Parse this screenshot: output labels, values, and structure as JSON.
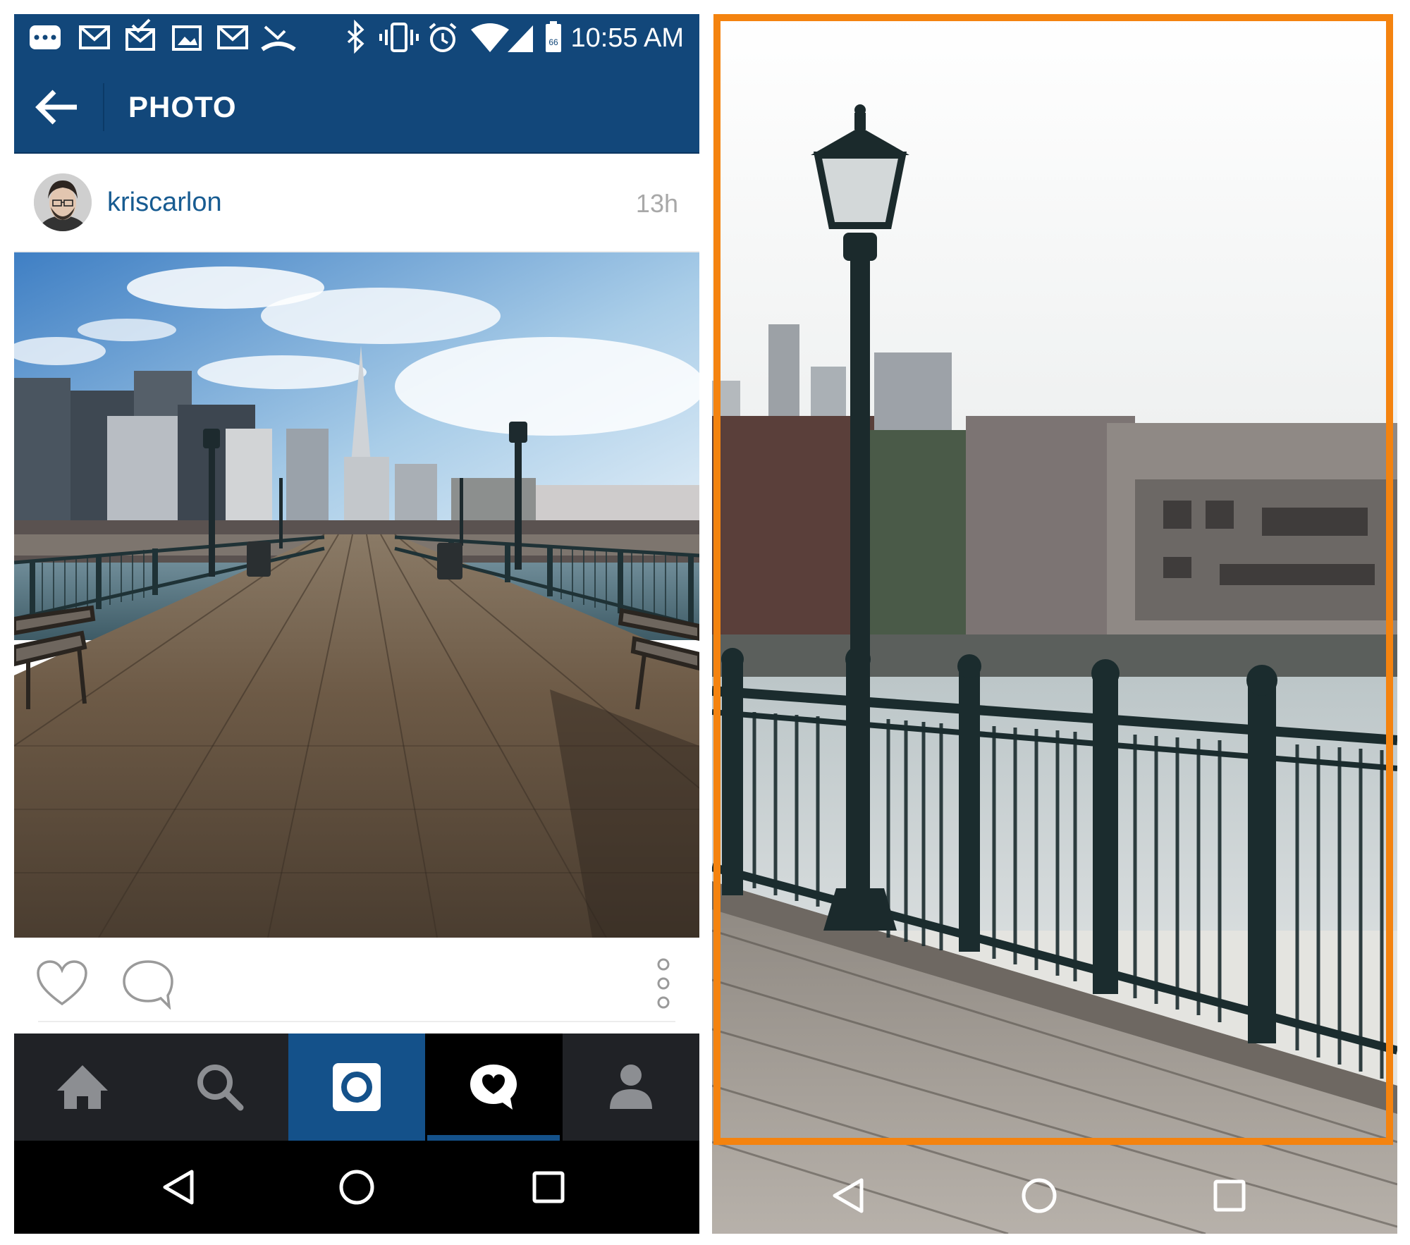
{
  "status_bar": {
    "time": "10:55 AM",
    "icons_left": [
      "messages-icon",
      "gmail-icon",
      "email-icon",
      "gallery-icon",
      "gmail-icon",
      "missed-call-icon"
    ],
    "icons_right": [
      "bluetooth-icon",
      "vibrate-icon",
      "alarm-icon",
      "wifi-icon",
      "cell-signal-icon",
      "battery-icon"
    ],
    "battery_level": "66"
  },
  "header": {
    "title": "PHOTO",
    "back_icon": "arrow-left-icon"
  },
  "post": {
    "username": "kriscarlon",
    "time_ago": "13h",
    "photo_subject": "pier-boardwalk-photo"
  },
  "actions": {
    "like_icon": "heart-outline-icon",
    "comment_icon": "comment-bubble-icon",
    "more_icon": "vertical-dots-icon"
  },
  "tab_bar": {
    "tabs": [
      "home-icon",
      "search-icon",
      "camera-icon",
      "activity-heart-icon",
      "profile-icon"
    ],
    "active_tab": "activity",
    "highlight_tab": "camera"
  },
  "nav_bar": {
    "keys": [
      "back-triangle-icon",
      "home-circle-icon",
      "recents-square-icon"
    ]
  },
  "zoom": {
    "frame_color": "#f4830f"
  },
  "colors": {
    "header_blue": "#12477a",
    "username_blue": "#175b91",
    "tab_bar_dark": "#202226",
    "tab_highlight": "#14518a"
  }
}
